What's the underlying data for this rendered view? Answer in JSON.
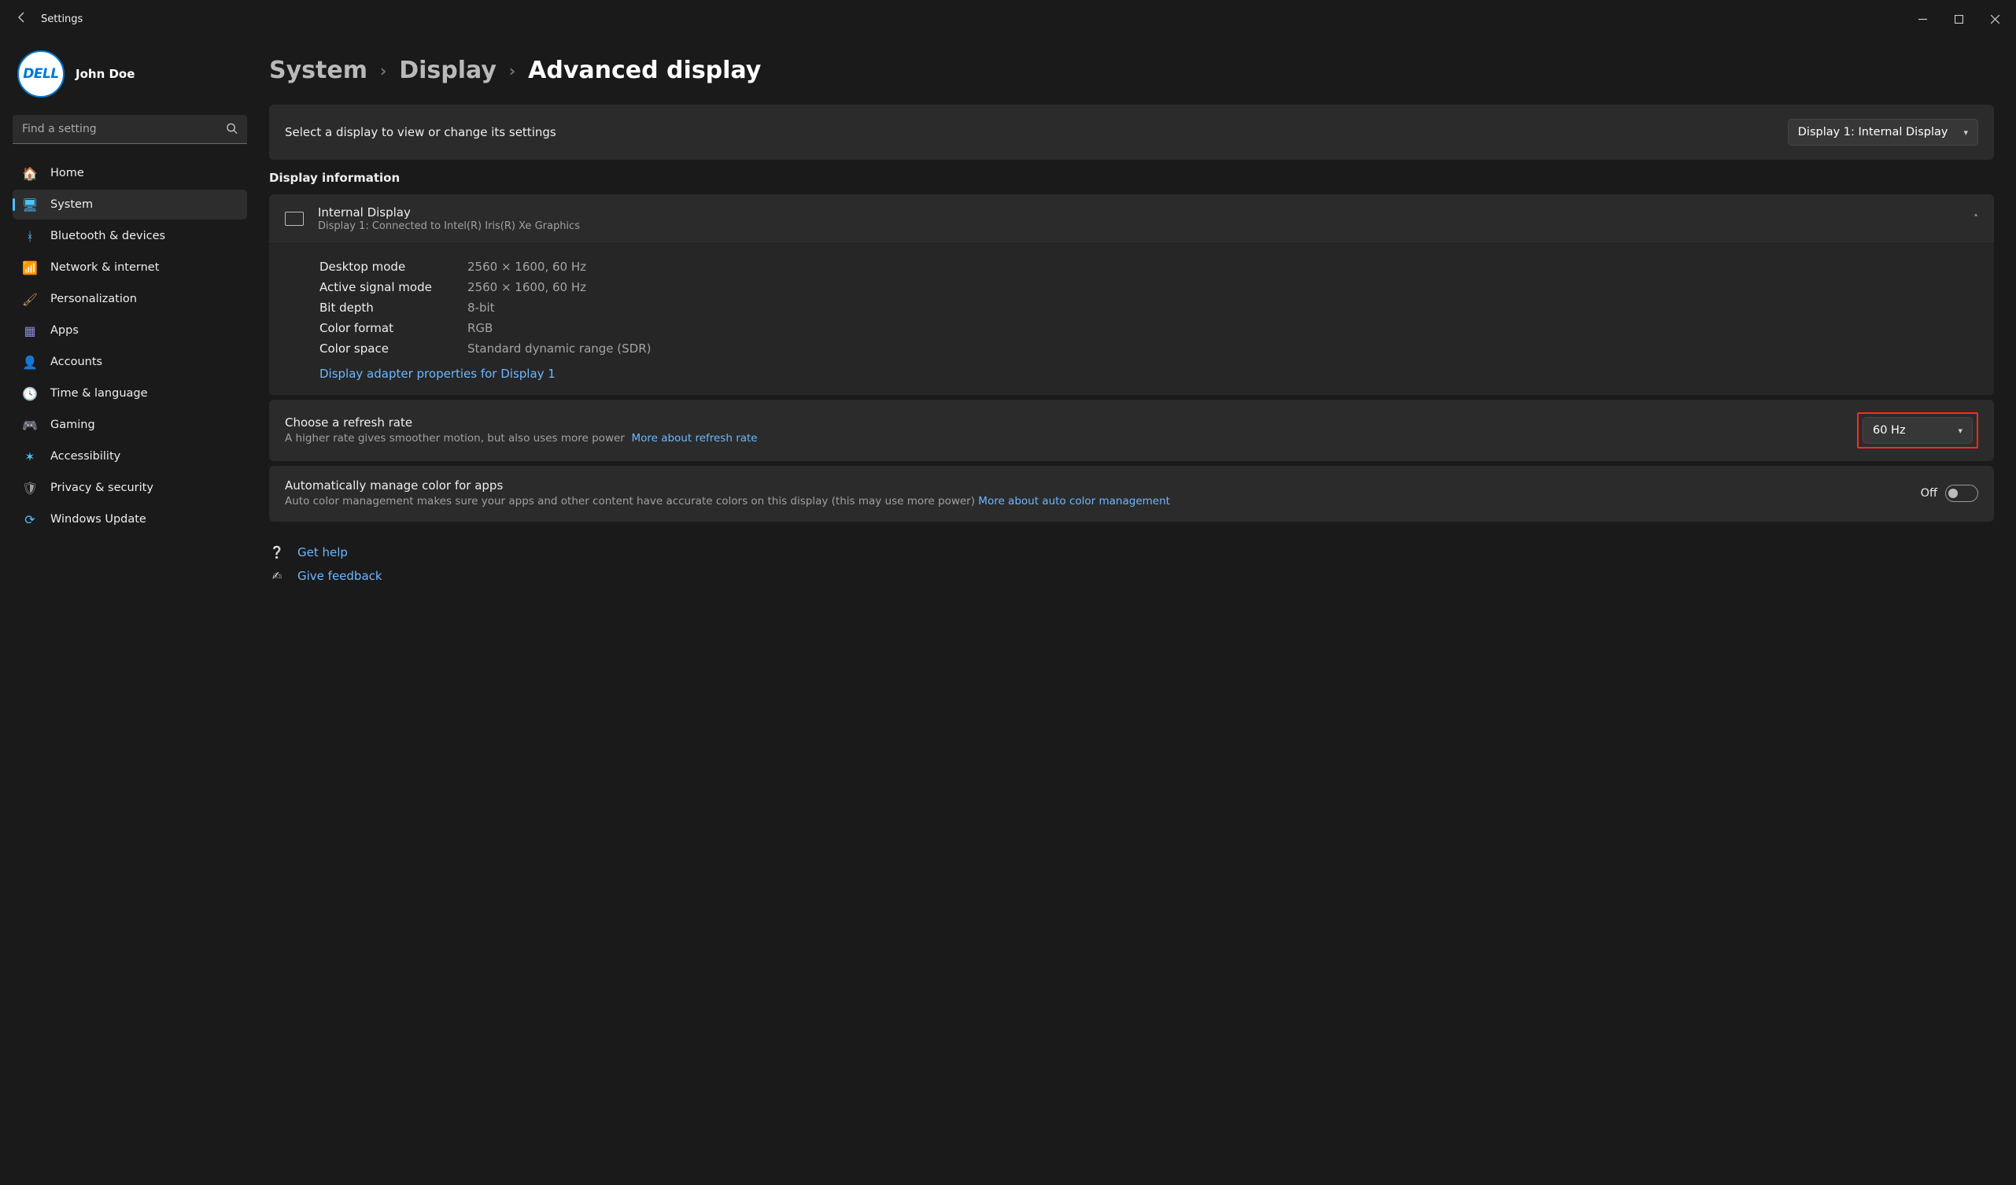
{
  "window": {
    "title": "Settings"
  },
  "user": {
    "name": "John Doe",
    "avatar_text": "DELL"
  },
  "search": {
    "placeholder": "Find a setting"
  },
  "sidebar": {
    "items": [
      {
        "label": "Home",
        "icon": "🏠",
        "color": "#e08a3a"
      },
      {
        "label": "System",
        "icon": "🖥",
        "color": "#4cc2ff",
        "active": true
      },
      {
        "label": "Bluetooth & devices",
        "icon": "ᚼ",
        "color": "#4cc2ff"
      },
      {
        "label": "Network & internet",
        "icon": "📶",
        "color": "#4cc2ff"
      },
      {
        "label": "Personalization",
        "icon": "🖌",
        "color": "#c99a63"
      },
      {
        "label": "Apps",
        "icon": "▦",
        "color": "#8a8ad6"
      },
      {
        "label": "Accounts",
        "icon": "👤",
        "color": "#3fbf6c"
      },
      {
        "label": "Time & language",
        "icon": "🕓",
        "color": "#4cc2ff"
      },
      {
        "label": "Gaming",
        "icon": "🎮",
        "color": "#bdbdbd"
      },
      {
        "label": "Accessibility",
        "icon": "✶",
        "color": "#4cc2ff"
      },
      {
        "label": "Privacy & security",
        "icon": "🛡",
        "color": "#9e9e9e"
      },
      {
        "label": "Windows Update",
        "icon": "⟳",
        "color": "#4cc2ff"
      }
    ]
  },
  "breadcrumb": {
    "a": "System",
    "b": "Display",
    "c": "Advanced display"
  },
  "display_selector": {
    "prompt": "Select a display to view or change its settings",
    "value": "Display 1: Internal Display"
  },
  "info_section_title": "Display information",
  "info_head": {
    "title": "Internal Display",
    "subtitle": "Display 1: Connected to Intel(R) Iris(R) Xe Graphics"
  },
  "info_rows": {
    "desktop_mode_k": "Desktop mode",
    "desktop_mode_v": "2560 × 1600, 60 Hz",
    "active_signal_k": "Active signal mode",
    "active_signal_v": "2560 × 1600, 60 Hz",
    "bit_depth_k": "Bit depth",
    "bit_depth_v": "8-bit",
    "color_format_k": "Color format",
    "color_format_v": "RGB",
    "color_space_k": "Color space",
    "color_space_v": "Standard dynamic range (SDR)"
  },
  "adapter_link": "Display adapter properties for Display 1",
  "refresh": {
    "title": "Choose a refresh rate",
    "subtitle": "A higher rate gives smoother motion, but also uses more power",
    "link": "More about refresh rate",
    "value": "60 Hz"
  },
  "color": {
    "title": "Automatically manage color for apps",
    "subtitle": "Auto color management makes sure your apps and other content have accurate colors on this display (this may use more power)",
    "link": "More about auto color management",
    "state_label": "Off"
  },
  "footer": {
    "help": "Get help",
    "feedback": "Give feedback"
  }
}
